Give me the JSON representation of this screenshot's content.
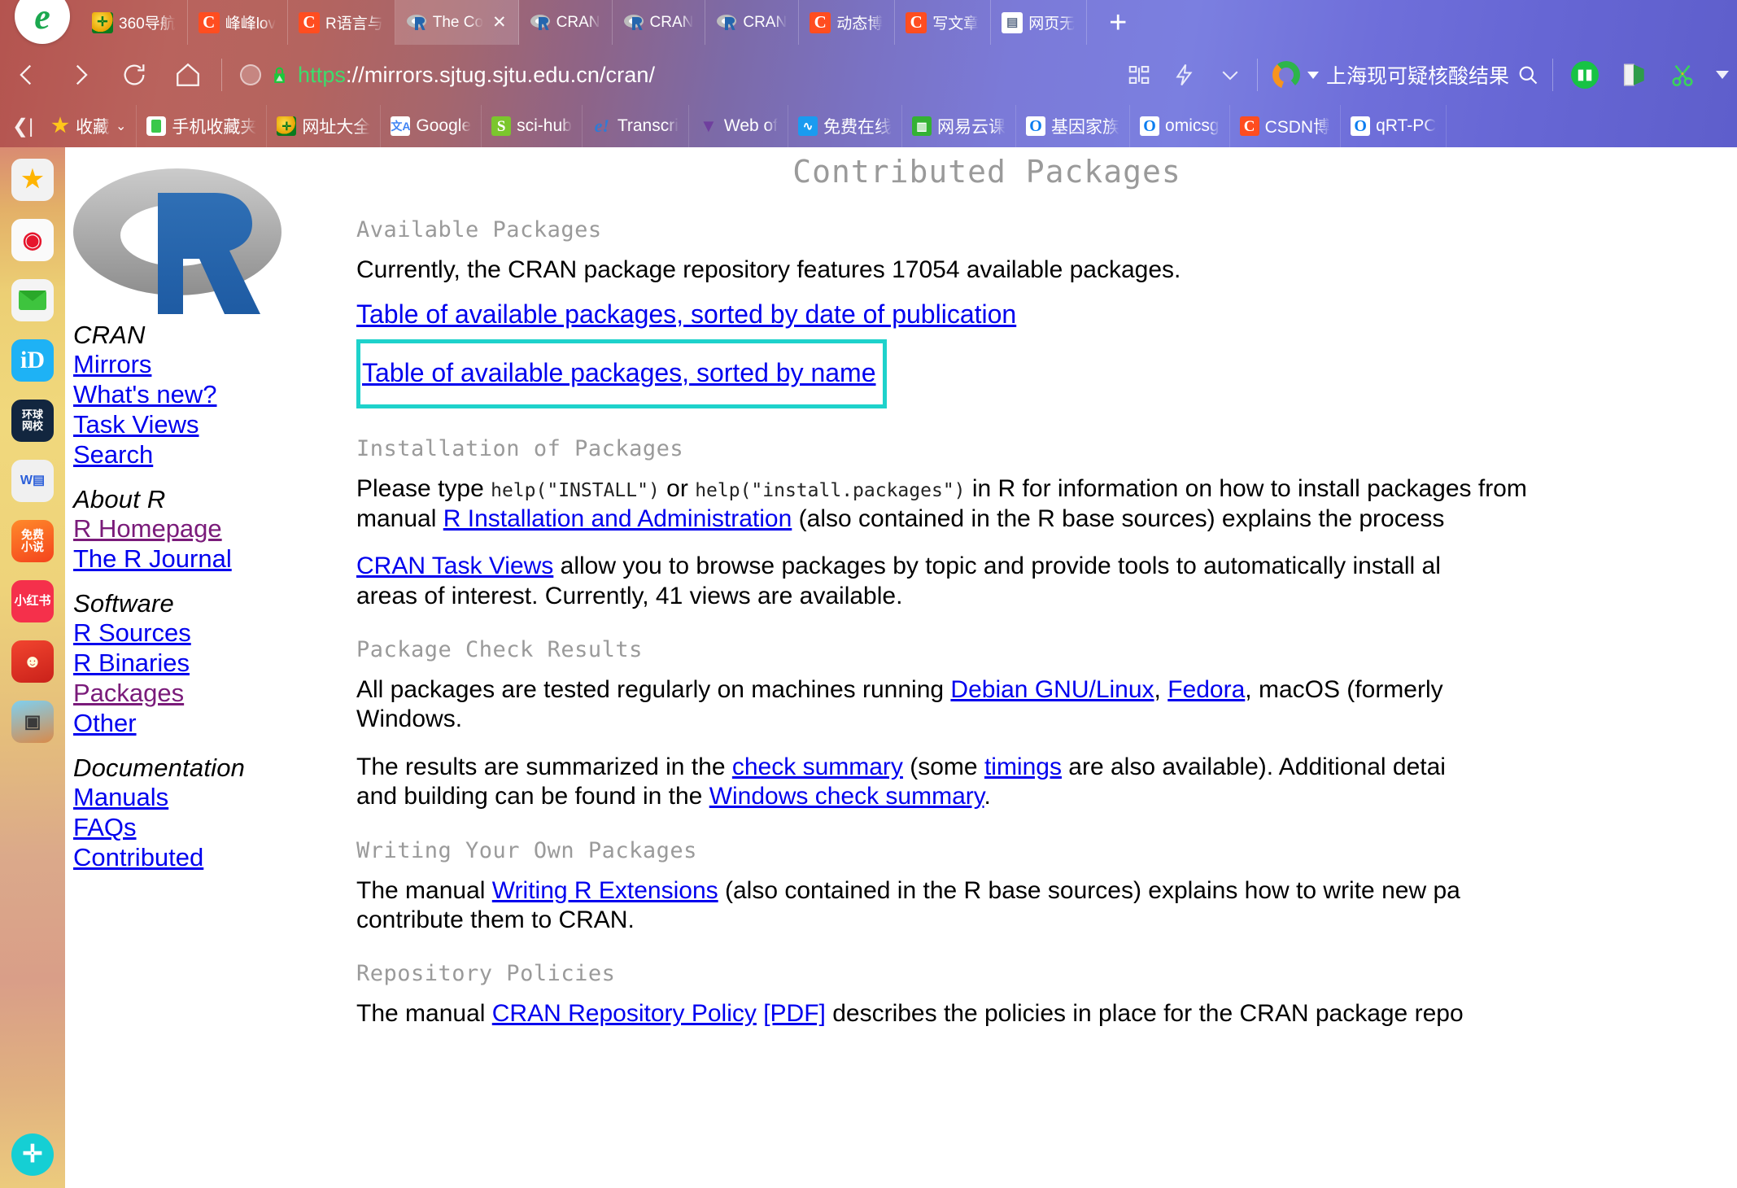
{
  "browser": {
    "brand_icon": "ie-e-icon",
    "tabs": [
      {
        "title": "360导航",
        "favicon": "360-icon",
        "active": false
      },
      {
        "title": "峰峰lov",
        "favicon": "csdn-icon",
        "active": false
      },
      {
        "title": "R语言与",
        "favicon": "csdn-icon",
        "active": false
      },
      {
        "title": "The Co",
        "favicon": "r-project-icon",
        "active": true
      },
      {
        "title": "CRAN",
        "favicon": "r-project-icon",
        "active": false
      },
      {
        "title": "CRAN",
        "favicon": "r-project-icon",
        "active": false
      },
      {
        "title": "CRAN",
        "favicon": "r-project-icon",
        "active": false
      },
      {
        "title": "动态博",
        "favicon": "csdn-icon",
        "active": false
      },
      {
        "title": "写文章",
        "favicon": "csdn-icon",
        "active": false
      },
      {
        "title": "网页无",
        "favicon": "document-icon",
        "active": false
      }
    ],
    "new_tab_label": "+",
    "close_label": "✕",
    "nav": {
      "back": "back-arrow",
      "forward": "forward-arrow",
      "reload": "reload-arrow",
      "home": "home-house"
    },
    "address": {
      "scheme": "https",
      "rest": "://mirrors.sjtug.sjtu.edu.cn/cran/",
      "full_url": "https://mirrors.sjtug.sjtu.edu.cn/cran/",
      "secure_icon": "green-lock-icon",
      "tracking_icon": "shield-circle-icon"
    },
    "search": {
      "engine_icon": "so-360-search-icon",
      "query": "上海现可疑核酸结果",
      "submit_icon": "magnifier-icon"
    },
    "bookmarks": [
      {
        "label": "收藏",
        "icon": "star-icon",
        "has_caret": true
      },
      {
        "label": "手机收藏夹",
        "icon": "phone-icon",
        "has_caret": false
      },
      {
        "label": "网址大全",
        "icon": "360-icon",
        "has_caret": false
      },
      {
        "label": "Google",
        "icon": "google-translate-icon",
        "has_caret": false
      },
      {
        "label": "sci-hub",
        "icon": "scihub-icon",
        "has_caret": false
      },
      {
        "label": "Transcri",
        "icon": "ie-e-icon",
        "has_caret": false
      },
      {
        "label": "Web of",
        "icon": "web-of-science-icon",
        "has_caret": false
      },
      {
        "label": "免费在线",
        "icon": "blue-app-icon",
        "has_caret": false
      },
      {
        "label": "网易云课",
        "icon": "netease-icon",
        "has_caret": false
      },
      {
        "label": "基因家族",
        "icon": "omics-icon",
        "has_caret": false
      },
      {
        "label": "omicsg",
        "icon": "omics-icon",
        "has_caret": false
      },
      {
        "label": "CSDN博",
        "icon": "csdn-icon",
        "has_caret": false
      },
      {
        "label": "qRT-PC",
        "icon": "omics-icon",
        "has_caret": false
      }
    ],
    "toolbar_icons": [
      "book-icon",
      "translate-icon",
      "scissors-screenshot-icon"
    ]
  },
  "dock": {
    "items": [
      {
        "name": "favorites-star-icon",
        "glyph": "★"
      },
      {
        "name": "weibo-icon",
        "glyph": "◉"
      },
      {
        "name": "mail-icon",
        "glyph": ""
      },
      {
        "name": "pptv-icon",
        "glyph": "ID"
      },
      {
        "name": "huanqiu-school-icon",
        "glyph": "环球\n网校"
      },
      {
        "name": "wps-document-icon",
        "glyph": "W"
      },
      {
        "name": "free-novel-icon",
        "glyph": "免费\n小说"
      },
      {
        "name": "xiaohongshu-icon",
        "glyph": "小红书"
      },
      {
        "name": "game-one-icon",
        "glyph": "☻"
      },
      {
        "name": "game-two-icon",
        "glyph": "▣"
      },
      {
        "name": "add-app-icon",
        "glyph": "✛"
      }
    ]
  },
  "page": {
    "logo_alt": "r-project-logo",
    "title": "Contributed Packages",
    "sidebar": [
      {
        "heading": "CRAN",
        "links": [
          {
            "label": "Mirrors",
            "visited": false
          },
          {
            "label": "What's new?",
            "visited": false
          },
          {
            "label": "Task Views",
            "visited": false
          },
          {
            "label": "Search",
            "visited": false
          }
        ]
      },
      {
        "heading": "About R",
        "links": [
          {
            "label": "R Homepage",
            "visited": true
          },
          {
            "label": "The R Journal",
            "visited": false
          }
        ]
      },
      {
        "heading": "Software",
        "links": [
          {
            "label": "R Sources",
            "visited": false
          },
          {
            "label": "R Binaries",
            "visited": false
          },
          {
            "label": "Packages",
            "visited": true
          },
          {
            "label": "Other",
            "visited": false
          }
        ]
      },
      {
        "heading": "Documentation",
        "links": [
          {
            "label": "Manuals",
            "visited": false
          },
          {
            "label": "FAQs",
            "visited": false
          },
          {
            "label": "Contributed",
            "visited": false
          }
        ]
      }
    ],
    "sections": {
      "available_packages": {
        "heading": "Available Packages",
        "intro_before": "Currently, the CRAN package repository features ",
        "package_count": "17054",
        "intro_after": " available packages.",
        "link_by_date": "Table of available packages, sorted by date of publication",
        "link_by_name": "Table of available packages, sorted by name",
        "highlight_color": "#1ed2cb"
      },
      "installation": {
        "heading": "Installation of Packages",
        "p1_a": "Please type ",
        "p1_code1": "help(\"INSTALL\")",
        "p1_b": " or ",
        "p1_code2": "help(\"install.packages\")",
        "p1_c": " in R for information on how to install packages from",
        "p1_d": "manual ",
        "p1_link": "R Installation and Administration",
        "p1_e": " (also contained in the R base sources) explains the process",
        "p2_link": "CRAN Task Views",
        "p2_a": " allow you to browse packages by topic and provide tools to automatically install al",
        "p2_b": "areas of interest. Currently, 41 views are available."
      },
      "check_results": {
        "heading": "Package Check Results",
        "p1_a": "All packages are tested regularly on machines running ",
        "p1_link1": "Debian GNU/Linux",
        "p1_sep": ", ",
        "p1_link2": "Fedora",
        "p1_b": ", macOS (formerly ",
        "p1_c": "Windows.",
        "p2_a": "The results are summarized in the ",
        "p2_link1": "check summary",
        "p2_b": " (some ",
        "p2_link2": "timings",
        "p2_c": " are also available). Additional detai",
        "p2_d": "and building can be found in the ",
        "p2_link3": "Windows check summary",
        "p2_e": "."
      },
      "writing": {
        "heading": "Writing Your Own Packages",
        "p1_a": "The manual ",
        "p1_link": "Writing R Extensions",
        "p1_b": " (also contained in the R base sources) explains how to write new pa",
        "p1_c": "contribute them to CRAN."
      },
      "policies": {
        "heading": "Repository Policies",
        "p1_a": "The manual ",
        "p1_link1": "CRAN Repository Policy",
        "p1_sp": " ",
        "p1_link2": "[PDF]",
        "p1_b": " describes the policies in place for the CRAN package repo"
      }
    }
  }
}
